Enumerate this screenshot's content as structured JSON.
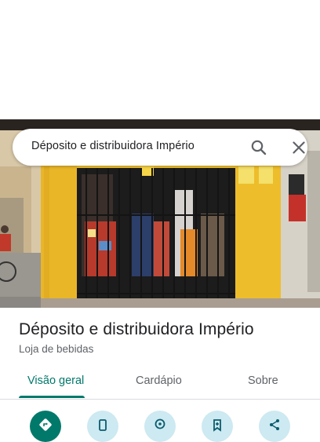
{
  "search": {
    "query": "Déposito e distribuidora Império"
  },
  "place": {
    "name": "Déposito e distribuidora Império",
    "category": "Loja de bebidas"
  },
  "tabs": [
    {
      "label": "Visão geral",
      "active": true
    },
    {
      "label": "Cardápio",
      "active": false
    },
    {
      "label": "Sobre",
      "active": false
    }
  ],
  "actions": [
    {
      "icon": "directions-icon"
    },
    {
      "icon": "phone-icon"
    },
    {
      "icon": "location-pin-icon"
    },
    {
      "icon": "save-icon"
    },
    {
      "icon": "share-icon"
    }
  ],
  "colors": {
    "accent": "#00796b",
    "action_secondary_bg": "#cde9f1",
    "storefront_wall": "#e8b93a"
  }
}
